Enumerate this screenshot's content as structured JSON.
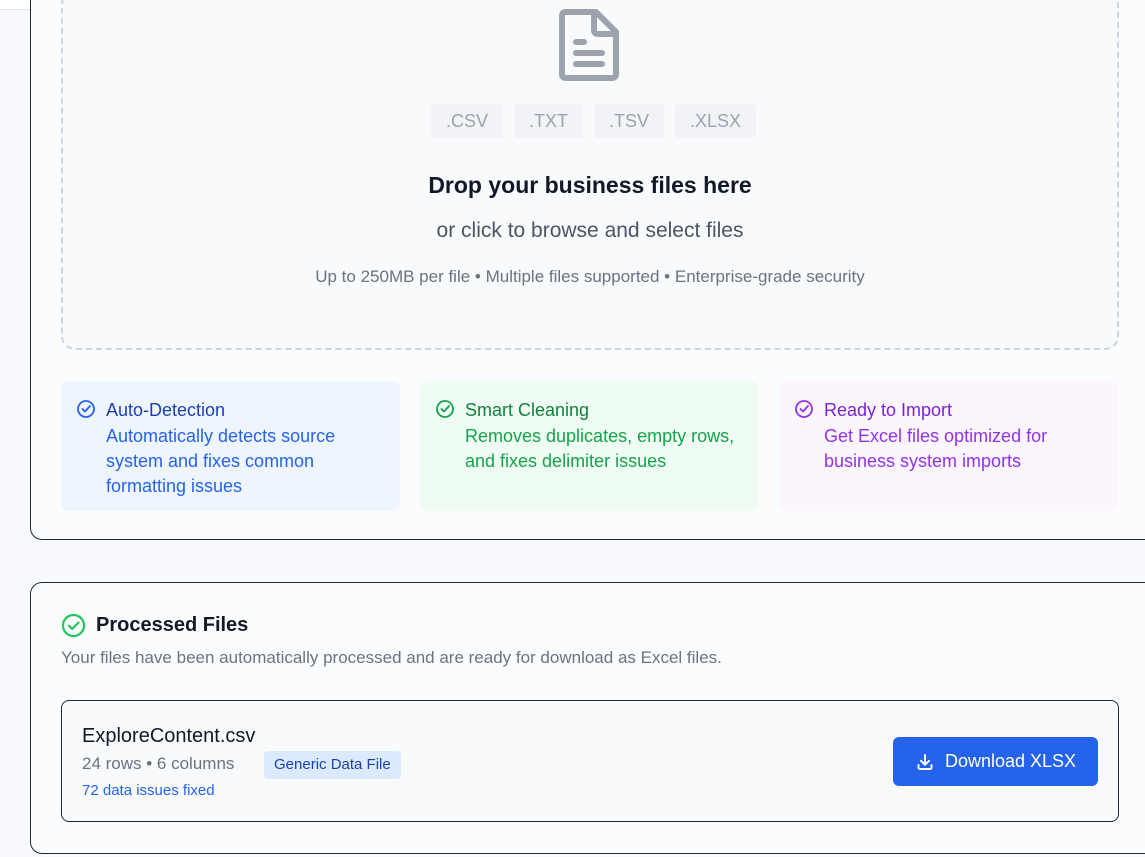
{
  "upload": {
    "extensions": [
      ".CSV",
      ".TXT",
      ".TSV",
      ".XLSX"
    ],
    "title": "Drop your business files here",
    "subtitle": "or click to browse and select files",
    "note": "Up to 250MB per file • Multiple files supported • Enterprise-grade security",
    "icon": "document-icon"
  },
  "features": [
    {
      "title": "Auto-Detection",
      "description": "Automatically detects source system and fixes common formatting issues",
      "icon": "check-circle-icon",
      "color": "#2563eb"
    },
    {
      "title": "Smart Cleaning",
      "description": "Removes duplicates, empty rows, and fixes delimiter issues",
      "icon": "check-circle-icon",
      "color": "#16a34a"
    },
    {
      "title": "Ready to Import",
      "description": "Get Excel files optimized for business system imports",
      "icon": "check-circle-icon",
      "color": "#9333ea"
    }
  ],
  "processed": {
    "title": "Processed Files",
    "subtitle": "Your files have been automatically processed and are ready for download as Excel files.",
    "icon_color": "#22c55e",
    "files": [
      {
        "name": "ExploreContent.csv",
        "meta": "24 rows • 6 columns",
        "badge": "Generic Data File",
        "issues": "72 data issues fixed",
        "download_label": "Download XLSX"
      }
    ]
  },
  "colors": {
    "accent": "#2563eb",
    "success": "#22c55e"
  }
}
